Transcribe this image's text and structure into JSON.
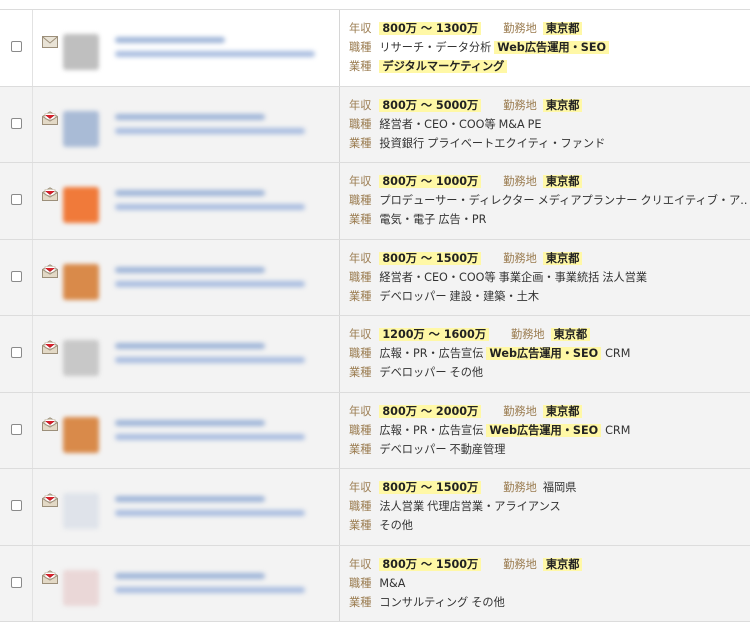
{
  "labels": {
    "salary": "年収",
    "location": "勤務地",
    "job_type": "職種",
    "industry": "業種"
  },
  "colors": {
    "highlight": "#fff8a6",
    "label": "#9a7b4f",
    "unread_bg": "#ffffff",
    "read_bg": "#f3f3f3"
  },
  "rows": [
    {
      "read": false,
      "icon": "closed-envelope-icon",
      "logo_color": "#bfbfbf",
      "salary": "800万 〜 1300万",
      "location": "東京都",
      "location_hl": true,
      "job_type": [
        "リサーチ・データ分析",
        "Web広告運用・SEO"
      ],
      "job_hl": [
        false,
        true
      ],
      "industry": [
        "デジタルマーケティング"
      ],
      "ind_hl": [
        true
      ]
    },
    {
      "read": true,
      "icon": "open-envelope-icon",
      "logo_color": "#a9bbd6",
      "salary": "800万 〜 5000万",
      "location": "東京都",
      "location_hl": true,
      "job_type": [
        "経営者・CEO・COO等",
        "M&A",
        "PE"
      ],
      "job_hl": [
        false,
        false,
        false
      ],
      "industry": [
        "投資銀行",
        "プライベートエクイティ・ファンド"
      ],
      "ind_hl": [
        false,
        false
      ]
    },
    {
      "read": true,
      "icon": "open-envelope-icon",
      "logo_color": "#f07a3a",
      "salary": "800万 〜 1000万",
      "location": "東京都",
      "location_hl": true,
      "job_type": [
        "プロデューサー・ディレクター",
        "メディアプランナー",
        "クリエイティブ・ア..."
      ],
      "job_hl": [
        false,
        false,
        false
      ],
      "industry": [
        "電気・電子",
        "広告・PR"
      ],
      "ind_hl": [
        false,
        false
      ]
    },
    {
      "read": true,
      "icon": "open-envelope-icon",
      "logo_color": "#d98a4a",
      "salary": "800万 〜 1500万",
      "location": "東京都",
      "location_hl": true,
      "job_type": [
        "経営者・CEO・COO等",
        "事業企画・事業統括",
        "法人営業"
      ],
      "job_hl": [
        false,
        false,
        false
      ],
      "industry": [
        "デベロッパー",
        "建設・建築・土木"
      ],
      "ind_hl": [
        false,
        false
      ]
    },
    {
      "read": true,
      "icon": "open-envelope-icon",
      "logo_color": "#c8c8c8",
      "salary": "1200万 〜 1600万",
      "location": "東京都",
      "location_hl": true,
      "job_type": [
        "広報・PR・広告宣伝",
        "Web広告運用・SEO",
        "CRM"
      ],
      "job_hl": [
        false,
        true,
        false
      ],
      "industry": [
        "デベロッパー",
        "その他"
      ],
      "ind_hl": [
        false,
        false
      ]
    },
    {
      "read": true,
      "icon": "open-envelope-icon",
      "logo_color": "#d98a4a",
      "salary": "800万 〜 2000万",
      "location": "東京都",
      "location_hl": true,
      "job_type": [
        "広報・PR・広告宣伝",
        "Web広告運用・SEO",
        "CRM"
      ],
      "job_hl": [
        false,
        true,
        false
      ],
      "industry": [
        "デベロッパー",
        "不動産管理"
      ],
      "ind_hl": [
        false,
        false
      ]
    },
    {
      "read": true,
      "icon": "open-envelope-icon",
      "logo_color": "#dfe3ea",
      "salary": "800万 〜 1500万",
      "location": "福岡県",
      "location_hl": false,
      "job_type": [
        "法人営業",
        "代理店営業・アライアンス"
      ],
      "job_hl": [
        false,
        false
      ],
      "industry": [
        "その他"
      ],
      "ind_hl": [
        false
      ]
    },
    {
      "read": true,
      "icon": "open-envelope-icon",
      "logo_color": "#ead7d7",
      "salary": "800万 〜 1500万",
      "location": "東京都",
      "location_hl": true,
      "job_type": [
        "M&A"
      ],
      "job_hl": [
        false
      ],
      "industry": [
        "コンサルティング",
        "その他"
      ],
      "ind_hl": [
        false,
        false
      ]
    }
  ]
}
